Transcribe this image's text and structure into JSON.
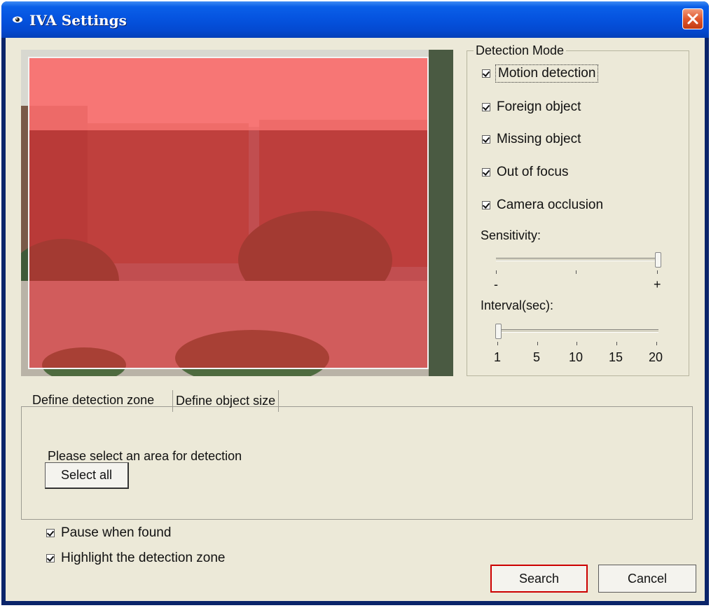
{
  "window": {
    "title": "IVA Settings",
    "icon": "eye-icon",
    "close_icon": "close-icon",
    "title_color": "#0554e0",
    "zone_color": "#e0272f"
  },
  "video": {
    "zone_overlay": "detection-zone-overlay"
  },
  "detection_mode": {
    "title": "Detection Mode",
    "options": [
      {
        "label": "Motion detection",
        "checked": true
      },
      {
        "label": "Foreign object",
        "checked": true
      },
      {
        "label": "Missing object",
        "checked": true
      },
      {
        "label": "Out of focus",
        "checked": true
      },
      {
        "label": "Camera occlusion",
        "checked": true
      }
    ],
    "sensitivity": {
      "label": "Sensitivity:",
      "min_label": "-",
      "max_label": "+",
      "level": 1.0
    },
    "interval": {
      "label": "Interval(sec):",
      "ticks": [
        "1",
        "5",
        "10",
        "15",
        "20"
      ],
      "value": 1
    }
  },
  "tabs": [
    {
      "label": "Define detection zone",
      "active": true
    },
    {
      "label": "Define object size",
      "active": false
    }
  ],
  "zone_panel": {
    "instruction": "Please select an area for detection",
    "select_all": "Select all"
  },
  "options": {
    "pause_when_found": "Pause when found",
    "highlight_zone": "Highlight the detection zone"
  },
  "buttons": {
    "search": "Search",
    "cancel": "Cancel"
  }
}
